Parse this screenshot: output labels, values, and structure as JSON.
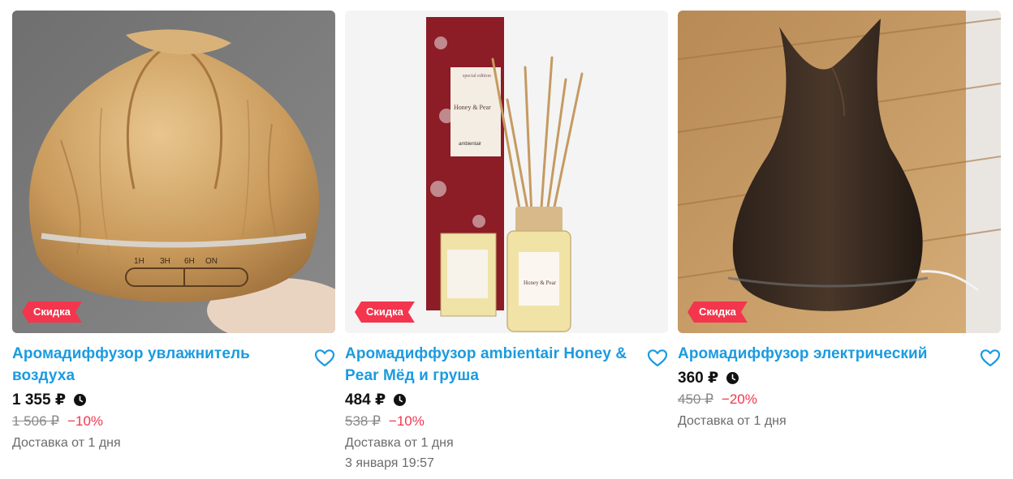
{
  "products": [
    {
      "badge": "Скидка",
      "title": "Аромадиффузор увлажнитель воздуха",
      "price": "1 355 ₽",
      "old_price": "1 506 ₽",
      "discount": "−10%",
      "delivery": "Доставка от 1 дня",
      "timer": "",
      "image_icon": "wood-bulb-diffuser-photo",
      "device_labels": [
        "1H",
        "3H",
        "6H",
        "ON"
      ]
    },
    {
      "badge": "Скидка",
      "title": "Аромадиффузор ambientair Honey & Pear Мёд и груша",
      "price": "484 ₽",
      "old_price": "538 ₽",
      "discount": "−10%",
      "delivery": "Доставка от 1 дня",
      "timer": "3 января 19:57",
      "image_icon": "reed-diffuser-box-photo",
      "box_texts": [
        "special edition",
        "Honey & Pear",
        "ambientair",
        "Honey & Pear"
      ]
    },
    {
      "badge": "Скидка",
      "title": "Аромадиффузор электрический",
      "price": "360 ₽",
      "old_price": "450 ₽",
      "discount": "−20%",
      "delivery": "Доставка от 1 дня",
      "timer": "",
      "image_icon": "dark-wood-tulip-diffuser-photo"
    }
  ],
  "colors": {
    "accent": "#1a9be0",
    "sale": "#f3354d",
    "muted": "#8a8a8a"
  }
}
